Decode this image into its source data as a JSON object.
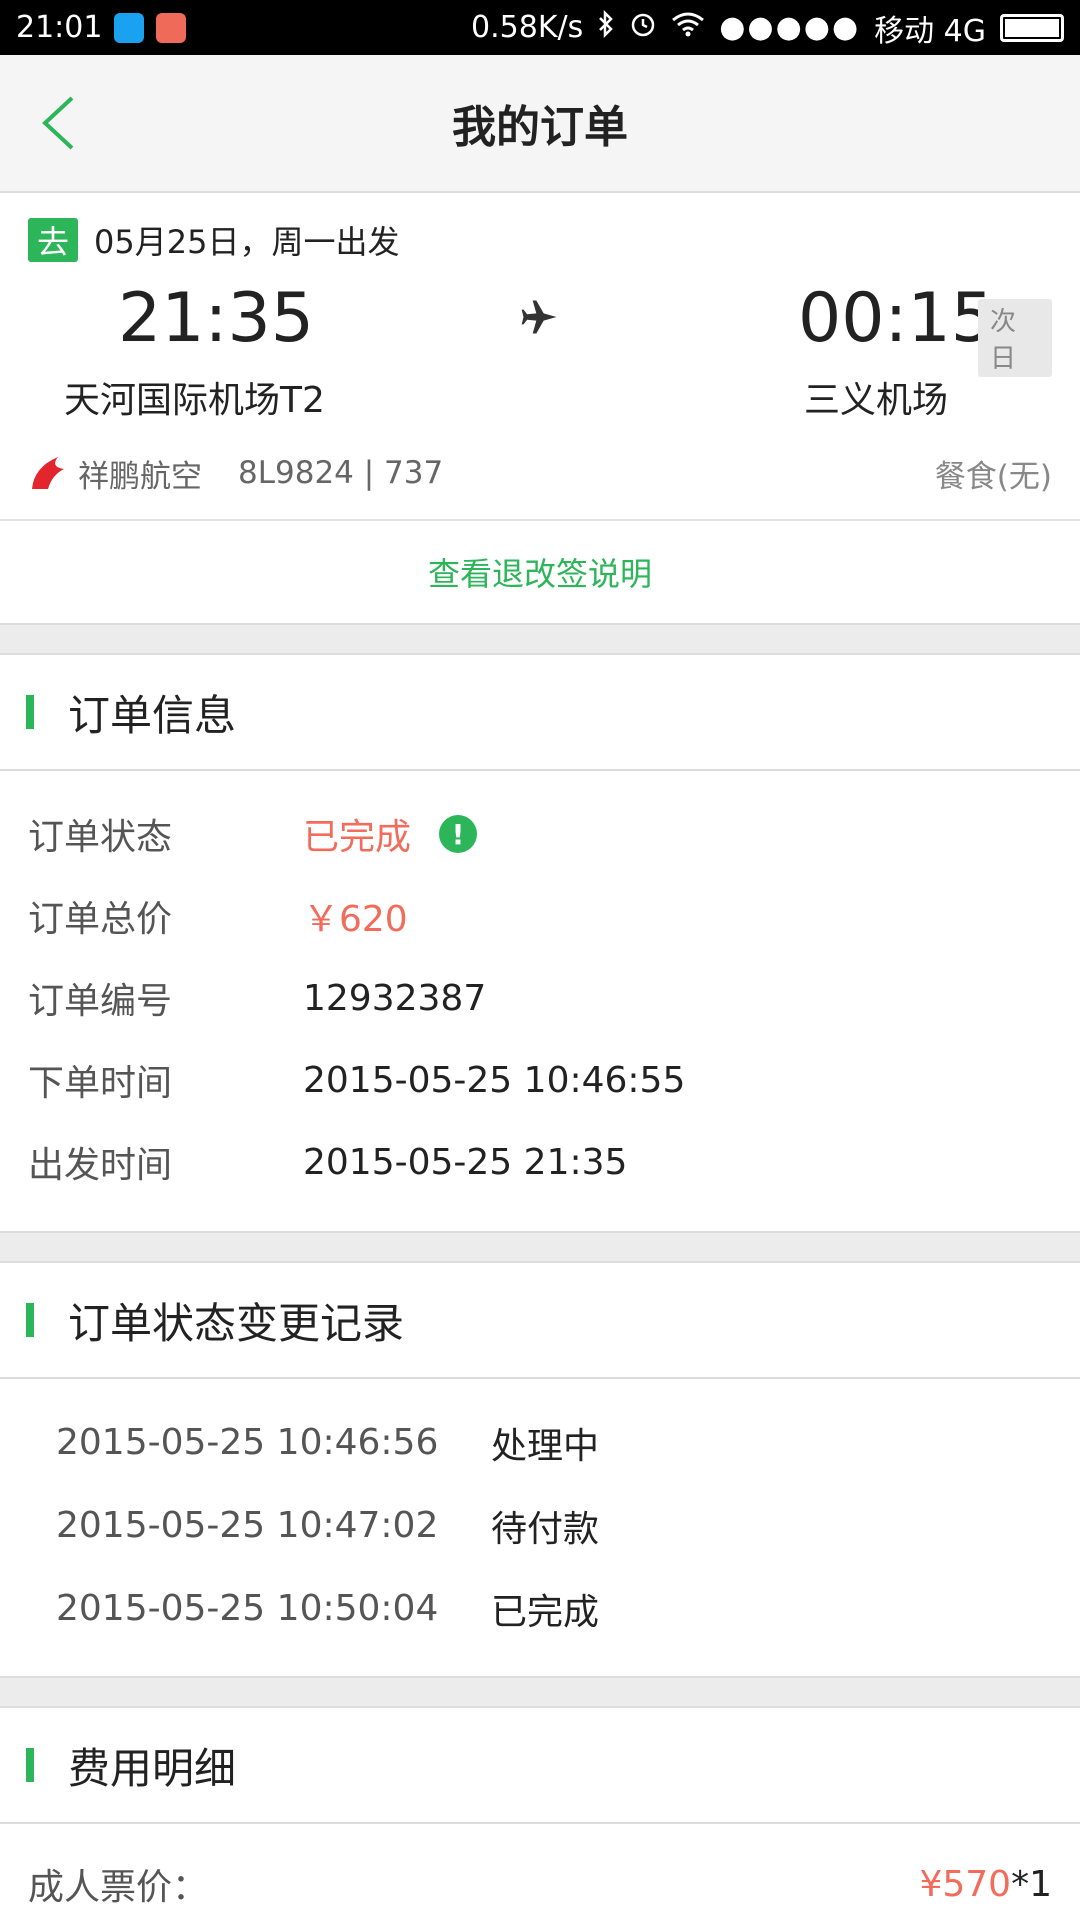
{
  "status_bar": {
    "time": "21:01",
    "speed": "0.58K/s",
    "signal_dots": "●●●●●",
    "carrier": "移动 4G"
  },
  "nav": {
    "title": "我的订单"
  },
  "flight": {
    "direction_badge": "去",
    "departure_date": "05月25日，周一出发",
    "departure_time": "21:35",
    "arrival_time": "00:15",
    "next_day_label": "次日",
    "departure_airport": "天河国际机场T2",
    "arrival_airport": "三义机场",
    "airline": "祥鹏航空",
    "flight_info": "8L9824 | 737",
    "meal": "餐食(无)"
  },
  "refund_link": "查看退改签说明",
  "order_info": {
    "title": "订单信息",
    "rows": [
      {
        "label": "订单状态",
        "value": "已完成"
      },
      {
        "label": "订单总价",
        "value": "￥620"
      },
      {
        "label": "订单编号",
        "value": "12932387"
      },
      {
        "label": "下单时间",
        "value": "2015-05-25 10:46:55"
      },
      {
        "label": "出发时间",
        "value": "2015-05-25 21:35"
      }
    ]
  },
  "status_log": {
    "title": "订单状态变更记录",
    "rows": [
      {
        "time": "2015-05-25 10:46:56",
        "status": "处理中"
      },
      {
        "time": "2015-05-25 10:47:02",
        "status": "待付款"
      },
      {
        "time": "2015-05-25 10:50:04",
        "status": "已完成"
      }
    ]
  },
  "fees": {
    "title": "费用明细",
    "adult_label": "成人票价：",
    "adult_price": "¥570",
    "adult_qty": "*1"
  },
  "colors": {
    "accent": "#2db55a",
    "price": "#f26b5b"
  }
}
